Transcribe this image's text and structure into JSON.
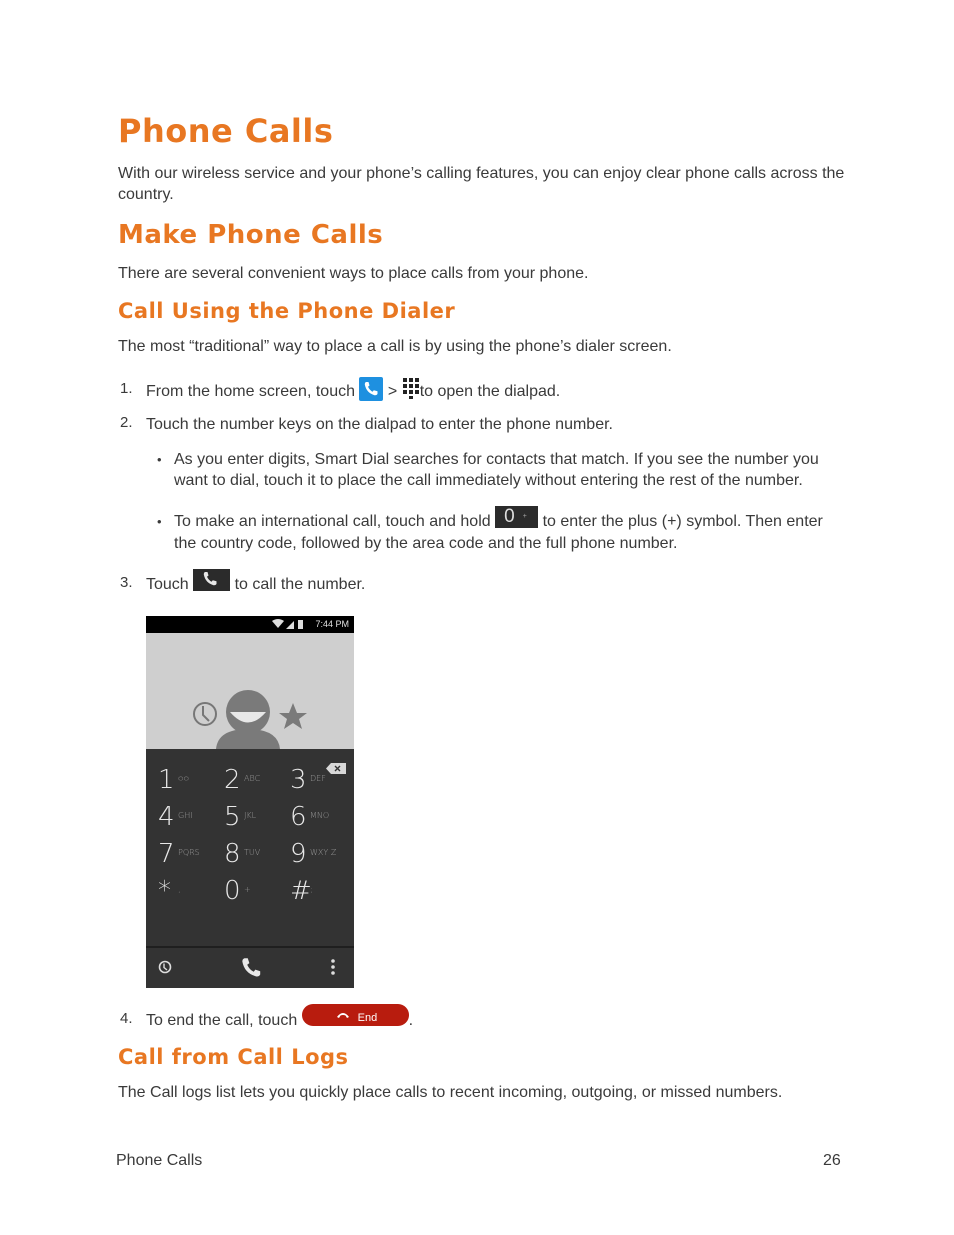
{
  "title": "Phone Calls",
  "intro": "With our wireless service and your phone’s calling features, you can enjoy clear phone calls across the country.",
  "section": {
    "heading": "Make Phone Calls",
    "text": "There are several convenient ways to place calls from your phone."
  },
  "subsection_dialer": {
    "heading": "Call Using the Phone Dialer",
    "text": "The most “traditional” way to place a call is by using the phone’s dialer screen.",
    "steps": [
      {
        "num": "1.",
        "before": "From the home screen, touch",
        "mid": ">",
        "after": "to open the dialpad.",
        "icons": [
          "phone-app-icon",
          "dialpad-grid-icon"
        ]
      },
      {
        "num": "2.",
        "text": "Touch the number keys on the dialpad to enter the phone number."
      },
      {
        "num": "3.",
        "before": "Touch",
        "after": "to call the number.",
        "icons": [
          "call-key-icon"
        ]
      },
      {
        "num": "4.",
        "before": "To end the call, touch",
        "after": ".",
        "end_label": "End"
      }
    ],
    "bullets": [
      {
        "text": "As you enter digits, Smart Dial searches for contacts that match. If you see the number you want to dial, touch it to place the call immediately without entering the rest of the number."
      },
      {
        "before": "To make an international call, touch and hold",
        "key_digit": "0",
        "key_sub": "+",
        "after": "to enter the plus (+) symbol. Then enter the country code, followed by the area code and the full phone number."
      }
    ]
  },
  "phone_screen": {
    "status_time": "7:44 PM",
    "keys": [
      {
        "digit": "1",
        "sub": "ᴑᴑ"
      },
      {
        "digit": "2",
        "sub": "ABC"
      },
      {
        "digit": "3",
        "sub": "DEF"
      },
      {
        "digit": "4",
        "sub": "GHI"
      },
      {
        "digit": "5",
        "sub": "JKL"
      },
      {
        "digit": "6",
        "sub": "MNO"
      },
      {
        "digit": "7",
        "sub": "PQRS"
      },
      {
        "digit": "8",
        "sub": "TUV"
      },
      {
        "digit": "9",
        "sub": "WXY Z"
      },
      {
        "digit": "*",
        "sub": ","
      },
      {
        "digit": "0",
        "sub": "+"
      },
      {
        "digit": "#",
        "sub": ";"
      }
    ]
  },
  "subsection_logs": {
    "heading": "Call from Call Logs",
    "text": "The Call logs list lets you quickly place calls to recent incoming, outgoing, or missed numbers."
  },
  "footer": {
    "section": "Phone Calls",
    "page": "26"
  },
  "colors": {
    "heading": "#e87722",
    "end_button": "#b81c0e",
    "phone_icon": "#1e90e0"
  }
}
